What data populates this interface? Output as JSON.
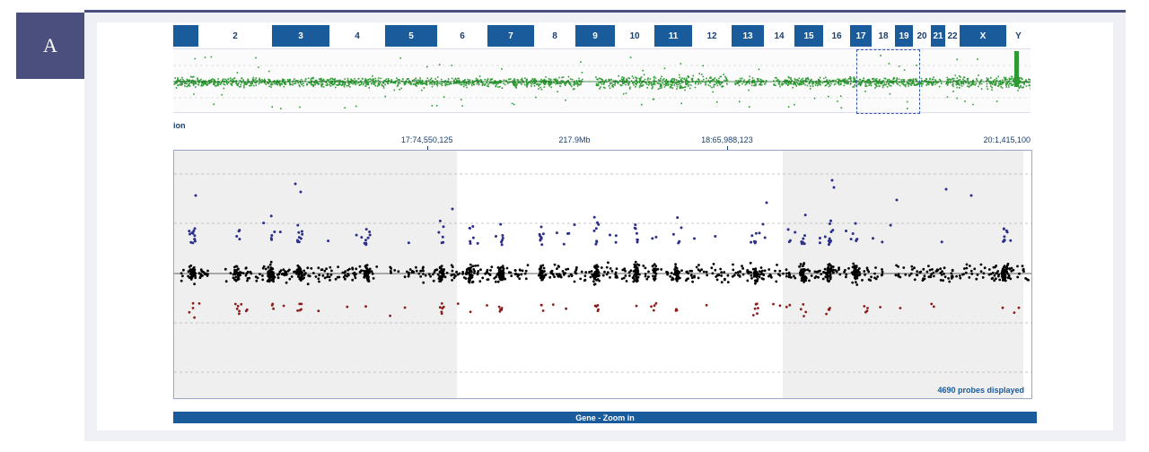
{
  "figure_label": "A",
  "chromosomes": [
    {
      "label": "",
      "dark": true,
      "w": 28
    },
    {
      "label": "2",
      "dark": false,
      "w": 82
    },
    {
      "label": "3",
      "dark": true,
      "w": 64
    },
    {
      "label": "4",
      "dark": false,
      "w": 62
    },
    {
      "label": "5",
      "dark": true,
      "w": 58
    },
    {
      "label": "6",
      "dark": false,
      "w": 56
    },
    {
      "label": "7",
      "dark": true,
      "w": 52
    },
    {
      "label": "8",
      "dark": false,
      "w": 46
    },
    {
      "label": "9",
      "dark": true,
      "w": 44
    },
    {
      "label": "10",
      "dark": false,
      "w": 44
    },
    {
      "label": "11",
      "dark": true,
      "w": 42
    },
    {
      "label": "12",
      "dark": false,
      "w": 44
    },
    {
      "label": "13",
      "dark": true,
      "w": 36
    },
    {
      "label": "14",
      "dark": false,
      "w": 34
    },
    {
      "label": "15",
      "dark": true,
      "w": 32
    },
    {
      "label": "16",
      "dark": false,
      "w": 30
    },
    {
      "label": "17",
      "dark": true,
      "w": 24
    },
    {
      "label": "18",
      "dark": false,
      "w": 26
    },
    {
      "label": "19",
      "dark": true,
      "w": 20
    },
    {
      "label": "20",
      "dark": false,
      "w": 20
    },
    {
      "label": "21",
      "dark": true,
      "w": 16
    },
    {
      "label": "22",
      "dark": false,
      "w": 16
    },
    {
      "label": "X",
      "dark": true,
      "w": 52
    },
    {
      "label": "Y",
      "dark": false,
      "w": 27
    }
  ],
  "section_label": "ion",
  "ruler": {
    "ticks": [
      {
        "label": "17:74,550,125",
        "pos": 0.296,
        "tick": true
      },
      {
        "label": "217.9Mb",
        "pos": 0.468,
        "tick": false
      },
      {
        "label": "18:65,988,123",
        "pos": 0.646,
        "tick": true
      },
      {
        "label": "20:1,415,100",
        "pos": 1.0,
        "tick": false
      }
    ]
  },
  "zoom_panel": {
    "probes_text": "4690 probes displayed",
    "highlight_start": 0.33,
    "highlight_end": 0.71
  },
  "gene_bar_label": "Gene - Zoom in",
  "colors": {
    "accent": "#1a5b9c",
    "frame": "#4a4f7e",
    "overview_dots": "#2e9a34",
    "gain_dots": "#2a2f8a",
    "loss_dots": "#8a1c1c",
    "neutral_dots": "#000000"
  }
}
